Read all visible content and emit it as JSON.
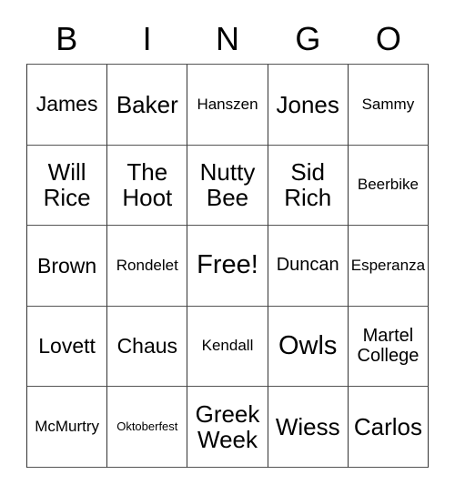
{
  "card": {
    "title": "BINGO",
    "free_space_label": "Free!",
    "columns": [
      {
        "letter": "B"
      },
      {
        "letter": "I"
      },
      {
        "letter": "N"
      },
      {
        "letter": "G"
      },
      {
        "letter": "O"
      }
    ],
    "rows": [
      {
        "cells": [
          {
            "text": "James",
            "size": "lg"
          },
          {
            "text": "Baker",
            "size": "xl"
          },
          {
            "text": "Hanszen",
            "size": "sm"
          },
          {
            "text": "Jones",
            "size": "xl"
          },
          {
            "text": "Sammy",
            "size": "sm"
          }
        ]
      },
      {
        "cells": [
          {
            "text": "Will\nRice",
            "size": "xl"
          },
          {
            "text": "The\nHoot",
            "size": "xl"
          },
          {
            "text": "Nutty\nBee",
            "size": "xl"
          },
          {
            "text": "Sid\nRich",
            "size": "xl"
          },
          {
            "text": "Beerbike",
            "size": "sm"
          }
        ]
      },
      {
        "cells": [
          {
            "text": "Brown",
            "size": "lg"
          },
          {
            "text": "Rondelet",
            "size": "sm"
          },
          {
            "text": "Free!",
            "size": "xxl"
          },
          {
            "text": "Duncan",
            "size": "md"
          },
          {
            "text": "Esperanza",
            "size": "sm"
          }
        ]
      },
      {
        "cells": [
          {
            "text": "Lovett",
            "size": "lg"
          },
          {
            "text": "Chaus",
            "size": "lg"
          },
          {
            "text": "Kendall",
            "size": "sm"
          },
          {
            "text": "Owls",
            "size": "xxl"
          },
          {
            "text": "Martel\nCollege",
            "size": "md"
          }
        ]
      },
      {
        "cells": [
          {
            "text": "McMurtry",
            "size": "sm"
          },
          {
            "text": "Oktoberfest",
            "size": "xs"
          },
          {
            "text": "Greek\nWeek",
            "size": "xl"
          },
          {
            "text": "Wiess",
            "size": "xl"
          },
          {
            "text": "Carlos",
            "size": "xl"
          }
        ]
      }
    ]
  },
  "colors": {
    "background": "#ffffff",
    "text": "#000000",
    "grid_line_vertical": "#333333",
    "grid_line_horizontal": "#555555"
  }
}
